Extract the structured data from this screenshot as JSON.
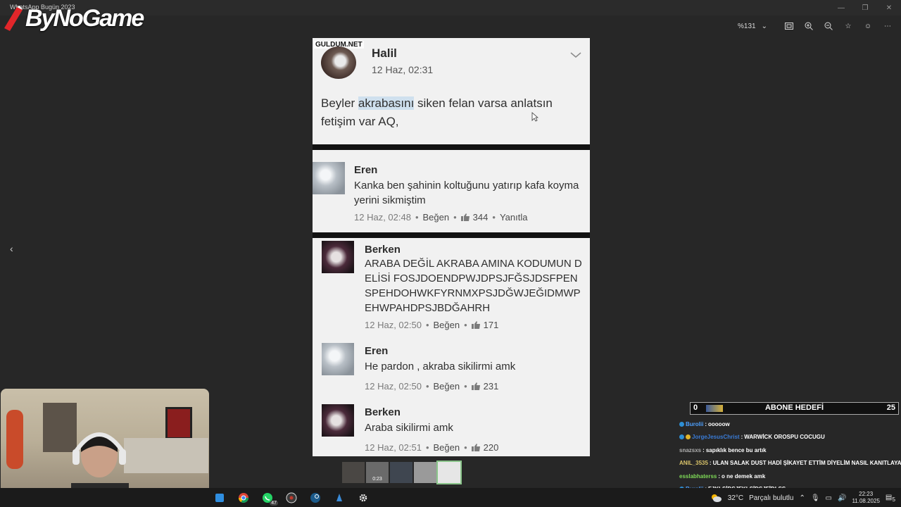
{
  "window": {
    "title": "WhatsApp Bugün 2023"
  },
  "logo": {
    "text": "ByNoGame"
  },
  "viewer": {
    "zoom_level": "%131",
    "icons": [
      "fit-screen-icon",
      "zoom-in-icon",
      "zoom-out-icon",
      "favorite-icon",
      "emoji-icon",
      "more-icon"
    ]
  },
  "post": {
    "watermark": "GULDUM.NET",
    "author": "Halil",
    "date": "12 Haz, 02:31",
    "text_before": "Beyler ",
    "text_highlight": "akrabasını",
    "text_after": " siken felan varsa anlatsın fetişim var AQ,"
  },
  "comments": [
    {
      "name": "Eren",
      "text": "Kanka ben şahinin koltuğunu yatırıp kafa koyma yerini sikmiştim",
      "time": "12 Haz, 02:48",
      "like_label": "Beğen",
      "likes": "344",
      "reply_label": "Yanıtla"
    },
    {
      "name": "Berken",
      "text": "ARABA DEĞİL AKRABA AMINA KODUMUN DELİSİ FOSJDOENDPWJDPSJFĞSJDSFPENSPEHDOHWKFYRNMXPSJDĞWJEĞIDMWPEHWPAHDPSJBDĞAHRH",
      "time": "12 Haz, 02:50",
      "like_label": "Beğen",
      "likes": "171"
    },
    {
      "name": "Eren",
      "text": "He pardon , akraba sikilirmi amk",
      "time": "12 Haz, 02:50",
      "like_label": "Beğen",
      "likes": "231"
    },
    {
      "name": "Berken",
      "text": "Araba sikilirmi amk",
      "time": "12 Haz, 02:51",
      "like_label": "Beğen",
      "likes": "220"
    }
  ],
  "thumbnails": [
    {
      "duration": ""
    },
    {
      "duration": "0:23"
    },
    {
      "duration": ""
    },
    {
      "duration": ""
    },
    {
      "duration": ""
    }
  ],
  "goal": {
    "current": "0",
    "title": "ABONE HEDEFİ",
    "target": "25"
  },
  "chat": [
    {
      "user": "Burolii",
      "user_color": "#4ea1ff",
      "msg": "ooooow"
    },
    {
      "user": "JorgeJesusChrist",
      "user_color": "#3a7bd5",
      "msg": "WARWİCK OROSPU COCUGU"
    },
    {
      "user": "snazsxs",
      "user_color": "#b0b0b0",
      "msg": "sapıklık bence bu artık"
    },
    {
      "user": "ANIL_3535",
      "user_color": "#d9c36a",
      "msg": "ULAN SALAK DUST HADİ ŞİKAYET ETTİM DİYELİM NASIL KANITLAYACAKSIN"
    },
    {
      "user": "esslabhaterss",
      "user_color": "#7ed957",
      "msg": "o ne demek amk"
    },
    {
      "user": "Burolii",
      "user_color": "#4ea1ff",
      "msg": "FJKLŞİDSJFKLŞİDSJFİDLSŞ"
    }
  ],
  "taskbar": {
    "whatsapp_badge": "47",
    "weather": "32°C",
    "weather_desc": "Parçalı bulutlu",
    "time": "22:23",
    "date": "11.08.2025",
    "notifications": "5"
  },
  "colors": {
    "background": "#272727",
    "chat_bar_border": "#aaaaaa",
    "highlight": "#cfe0ee"
  }
}
